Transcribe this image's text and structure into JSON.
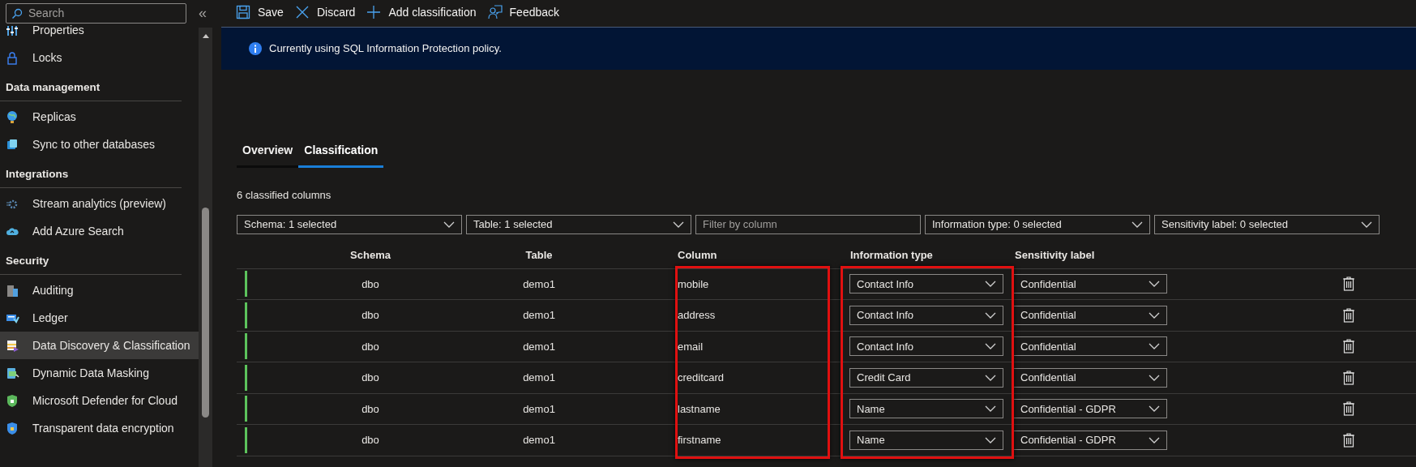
{
  "sidebar": {
    "search": {
      "placeholder": "Search"
    },
    "collapse": "«",
    "sections": [
      {
        "items": [
          {
            "label": "Properties",
            "selected": false
          },
          {
            "label": "Locks",
            "selected": false
          }
        ]
      },
      {
        "title": "Data management",
        "items": [
          {
            "label": "Replicas",
            "selected": false
          },
          {
            "label": "Sync to other databases",
            "selected": false
          }
        ]
      },
      {
        "title": "Integrations",
        "items": [
          {
            "label": "Stream analytics (preview)",
            "selected": false
          },
          {
            "label": "Add Azure Search",
            "selected": false
          }
        ]
      },
      {
        "title": "Security",
        "items": [
          {
            "label": "Auditing",
            "selected": false
          },
          {
            "label": "Ledger",
            "selected": false
          },
          {
            "label": "Data Discovery & Classification",
            "selected": true
          },
          {
            "label": "Dynamic Data Masking",
            "selected": false
          },
          {
            "label": "Microsoft Defender for Cloud",
            "selected": false
          },
          {
            "label": "Transparent data encryption",
            "selected": false
          }
        ]
      }
    ]
  },
  "toolbar": [
    {
      "label": "Save",
      "kind": "save"
    },
    {
      "label": "Discard",
      "kind": "discard"
    },
    {
      "label": "Add classification",
      "kind": "add"
    },
    {
      "label": "Feedback",
      "kind": "feedback"
    }
  ],
  "banner": {
    "text": "Currently using SQL Information Protection policy."
  },
  "tabs": [
    {
      "label": "Overview",
      "selected": false
    },
    {
      "label": "Classification",
      "selected": true
    }
  ],
  "summary": "6 classified columns",
  "filters": [
    {
      "kind": "dropdown",
      "label": "Schema: 1 selected"
    },
    {
      "kind": "dropdown",
      "label": "Table: 1 selected"
    },
    {
      "kind": "text",
      "placeholder": "Filter by column"
    },
    {
      "kind": "dropdown",
      "label": "Information type: 0 selected"
    },
    {
      "kind": "dropdown",
      "label": "Sensitivity label: 0 selected"
    }
  ],
  "table": {
    "columns": [
      "Schema",
      "Table",
      "Column",
      "Information type",
      "Sensitivity label"
    ],
    "rows": [
      {
        "modified": true,
        "schema": "dbo",
        "table": "demo1",
        "column": "mobile",
        "information_type": "Contact Info",
        "sensitivity_label": "Confidential"
      },
      {
        "modified": true,
        "schema": "dbo",
        "table": "demo1",
        "column": "address",
        "information_type": "Contact Info",
        "sensitivity_label": "Confidential"
      },
      {
        "modified": true,
        "schema": "dbo",
        "table": "demo1",
        "column": "email",
        "information_type": "Contact Info",
        "sensitivity_label": "Confidential"
      },
      {
        "modified": true,
        "schema": "dbo",
        "table": "demo1",
        "column": "creditcard",
        "information_type": "Credit Card",
        "sensitivity_label": "Confidential"
      },
      {
        "modified": true,
        "schema": "dbo",
        "table": "demo1",
        "column": "lastname",
        "information_type": "Name",
        "sensitivity_label": "Confidential - GDPR"
      },
      {
        "modified": true,
        "schema": "dbo",
        "table": "demo1",
        "column": "firstname",
        "information_type": "Name",
        "sensitivity_label": "Confidential - GDPR"
      }
    ]
  }
}
